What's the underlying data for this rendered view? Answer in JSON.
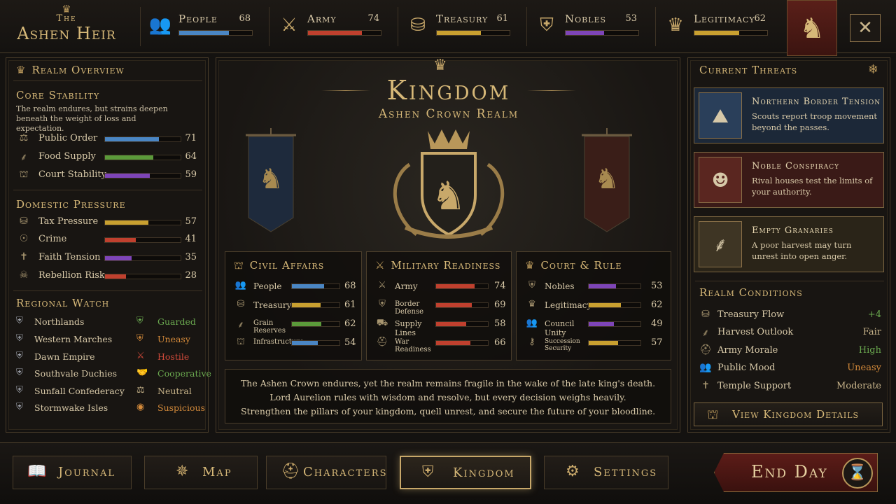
{
  "logo": {
    "crown": "♛",
    "the": "The",
    "name": "Ashen Heir"
  },
  "top_stats": [
    {
      "label": "People",
      "value": "68",
      "icon": "people-icon",
      "glyph": "👥",
      "fill": 0.68,
      "color": "#4a86c4"
    },
    {
      "label": "Army",
      "value": "74",
      "icon": "crossed-swords-icon",
      "glyph": "⚔",
      "fill": 0.74,
      "color": "#c0402e"
    },
    {
      "label": "Treasury",
      "value": "61",
      "icon": "coins-icon",
      "glyph": "⛁",
      "fill": 0.61,
      "color": "#c9a030"
    },
    {
      "label": "Nobles",
      "value": "53",
      "icon": "shield-crest-icon",
      "glyph": "⛨",
      "fill": 0.53,
      "color": "#7e45b8"
    },
    {
      "label": "Legitimacy",
      "value": "62",
      "icon": "crown-icon",
      "glyph": "♛",
      "fill": 0.62,
      "color": "#c9a030"
    }
  ],
  "banner_glyph": "♞",
  "close_glyph": "✕",
  "left": {
    "title": "Realm Overview",
    "core": {
      "heading": "Core Stability",
      "desc": "The realm endures, but strains deepen beneath the weight of loss and expectation.",
      "rows": [
        {
          "label": "Public Order",
          "value": "71",
          "glyph": "⚖",
          "fill": 0.71,
          "color": "#4a86c4"
        },
        {
          "label": "Food Supply",
          "value": "64",
          "glyph": "⸙",
          "fill": 0.64,
          "color": "#5b9a3a"
        },
        {
          "label": "Court Stability",
          "value": "59",
          "glyph": "⛫",
          "fill": 0.59,
          "color": "#7e45b8"
        }
      ]
    },
    "domestic": {
      "heading": "Domestic Pressure",
      "rows": [
        {
          "label": "Tax Pressure",
          "value": "57",
          "glyph": "⛁",
          "fill": 0.57,
          "color": "#c9a030"
        },
        {
          "label": "Crime",
          "value": "41",
          "glyph": "☉",
          "fill": 0.41,
          "color": "#c0402e"
        },
        {
          "label": "Faith Tension",
          "value": "35",
          "glyph": "✝",
          "fill": 0.35,
          "color": "#7e45b8"
        },
        {
          "label": "Rebellion Risk",
          "value": "28",
          "glyph": "☠",
          "fill": 0.28,
          "color": "#c0402e"
        }
      ]
    },
    "regional": {
      "heading": "Regional Watch",
      "rows": [
        {
          "name": "Northlands",
          "status": "Guarded",
          "status_glyph": "⛨",
          "status_color": "#6aa84f"
        },
        {
          "name": "Western Marches",
          "status": "Uneasy",
          "status_glyph": "⛨",
          "status_color": "#d48a3a"
        },
        {
          "name": "Dawn Empire",
          "status": "Hostile",
          "status_glyph": "⚔",
          "status_color": "#d04a3a"
        },
        {
          "name": "Southvale Duchies",
          "status": "Cooperative",
          "status_glyph": "🤝",
          "status_color": "#6aa84f"
        },
        {
          "name": "Sunfall Confederacy",
          "status": "Neutral",
          "status_glyph": "⚖",
          "status_color": "#c8b48a"
        },
        {
          "name": "Stormwake Isles",
          "status": "Suspicious",
          "status_glyph": "◉",
          "status_color": "#d48a3a"
        }
      ]
    }
  },
  "center": {
    "title": "Kingdom",
    "subtitle": "Ashen Crown Realm",
    "civil": {
      "heading": "Civil Affairs",
      "rows": [
        {
          "label": "People",
          "value": "68",
          "glyph": "👥",
          "fill": 0.68,
          "color": "#4a86c4"
        },
        {
          "label": "Treasury",
          "value": "61",
          "glyph": "⛁",
          "fill": 0.61,
          "color": "#c9a030"
        },
        {
          "label": "Grain Reserves",
          "value": "62",
          "glyph": "⸙",
          "fill": 0.62,
          "color": "#5b9a3a"
        },
        {
          "label": "Infrastructure",
          "value": "54",
          "glyph": "⛫",
          "fill": 0.54,
          "color": "#4a86c4"
        }
      ]
    },
    "military": {
      "heading": "Military Readiness",
      "rows": [
        {
          "label": "Army",
          "value": "74",
          "glyph": "⚔",
          "fill": 0.74,
          "color": "#c0402e"
        },
        {
          "label": "Border Defense",
          "value": "69",
          "glyph": "⛨",
          "fill": 0.69,
          "color": "#c0402e"
        },
        {
          "label": "Supply Lines",
          "value": "58",
          "glyph": "⛟",
          "fill": 0.58,
          "color": "#c0402e"
        },
        {
          "label": "War Readiness",
          "value": "66",
          "glyph": "⛑",
          "fill": 0.66,
          "color": "#c0402e"
        }
      ]
    },
    "court": {
      "heading": "Court & Rule",
      "rows": [
        {
          "label": "Nobles",
          "value": "53",
          "glyph": "⛨",
          "fill": 0.53,
          "color": "#7e45b8"
        },
        {
          "label": "Legitimacy",
          "value": "62",
          "glyph": "♛",
          "fill": 0.62,
          "color": "#c9a030"
        },
        {
          "label": "Council Unity",
          "value": "49",
          "glyph": "👥",
          "fill": 0.49,
          "color": "#7e45b8"
        },
        {
          "label": "Succession Security",
          "value": "57",
          "glyph": "⚷",
          "fill": 0.57,
          "color": "#c9a030"
        }
      ]
    },
    "narrative": [
      "The Ashen Crown endures, yet the realm remains fragile in the wake of the late king's death.",
      "Lord Aurelion rules with wisdom and resolve, but every decision weighs heavily.",
      "Strengthen the pillars of your kingdom, quell unrest, and secure the future of your bloodline."
    ]
  },
  "right": {
    "threats_title": "Current Threats",
    "threats": [
      {
        "title": "Northern Border Tension",
        "desc": "Scouts report troop movement beyond the passes.",
        "glyph": "⛰",
        "bg": "#1c2838",
        "icon_bg": "#2a3f5a"
      },
      {
        "title": "Noble Conspiracy",
        "desc": "Rival houses test the limits of your authority.",
        "glyph": "☻",
        "bg": "#3a1a17",
        "icon_bg": "#5a2620"
      },
      {
        "title": "Empty Granaries",
        "desc": "A poor harvest may turn unrest into open anger.",
        "glyph": "⸙",
        "bg": "#2a2418",
        "icon_bg": "#3e3524"
      }
    ],
    "conditions_title": "Realm Conditions",
    "conditions": [
      {
        "label": "Treasury Flow",
        "value": "+4",
        "glyph": "⛁",
        "color": "#6aa84f"
      },
      {
        "label": "Harvest Outlook",
        "value": "Fair",
        "glyph": "⸙",
        "color": "#c8b48a"
      },
      {
        "label": "Army Morale",
        "value": "High",
        "glyph": "⛑",
        "color": "#6aa84f"
      },
      {
        "label": "Public Mood",
        "value": "Uneasy",
        "glyph": "👥",
        "color": "#d48a3a"
      },
      {
        "label": "Temple Support",
        "value": "Moderate",
        "glyph": "✝",
        "color": "#c8b48a"
      }
    ],
    "details_button": "View Kingdom Details"
  },
  "nav": [
    {
      "label": "Journal",
      "glyph": "📖",
      "icon": "book-icon"
    },
    {
      "label": "Map",
      "glyph": "✵",
      "icon": "compass-icon"
    },
    {
      "label": "Characters",
      "glyph": "⛑",
      "icon": "helmet-icon"
    },
    {
      "label": "Kingdom",
      "glyph": "⛨",
      "icon": "crest-icon",
      "active": true
    },
    {
      "label": "Settings",
      "glyph": "⚙",
      "icon": "gear-icon"
    }
  ],
  "end_day": {
    "label": "End Day",
    "glyph": "⌛"
  }
}
